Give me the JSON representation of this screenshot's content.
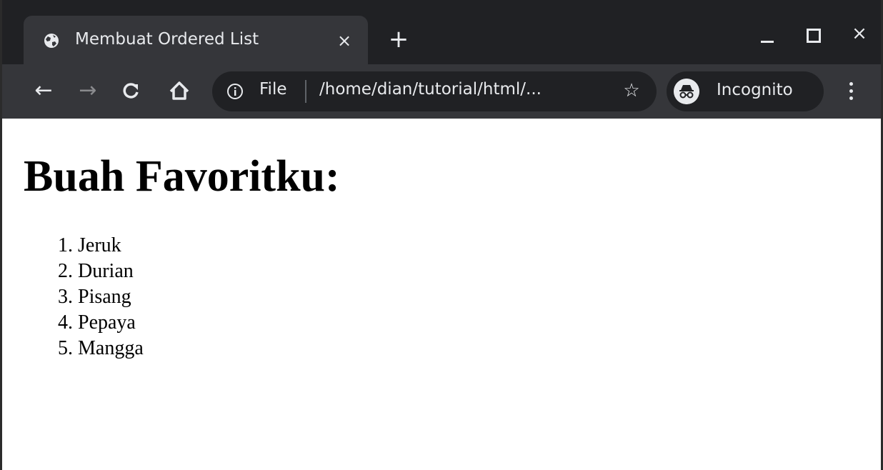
{
  "browser": {
    "tab": {
      "title": "Membuat Ordered List",
      "close_glyph": "×",
      "icon": "globe-icon"
    },
    "new_tab_glyph": "+",
    "window_controls": {
      "close_glyph": "×",
      "icons": [
        "minimize-icon",
        "maximize-icon",
        "close-icon"
      ]
    },
    "nav": {
      "back_glyph": "←",
      "forward_glyph": "→",
      "reload_glyph": "C",
      "home_glyph": "⌂"
    },
    "omnibox": {
      "scheme": "File",
      "url": "/home/dian/tutorial/html/...",
      "star_glyph": "☆",
      "info_icon": "info-icon"
    },
    "profile": {
      "label": "Incognito",
      "icon": "incognito-icon"
    },
    "menu_icon": "kebab-menu-icon",
    "colors": {
      "frame": "#202124",
      "toolbar": "#35363a",
      "text": "#e8eaed"
    }
  },
  "page": {
    "heading": "Buah Favoritku:",
    "list": [
      {
        "marker": "1.",
        "text": "Jeruk"
      },
      {
        "marker": "2.",
        "text": "Durian"
      },
      {
        "marker": "3.",
        "text": "Pisang"
      },
      {
        "marker": "4.",
        "text": "Pepaya"
      },
      {
        "marker": "5.",
        "text": "Mangga"
      }
    ]
  }
}
